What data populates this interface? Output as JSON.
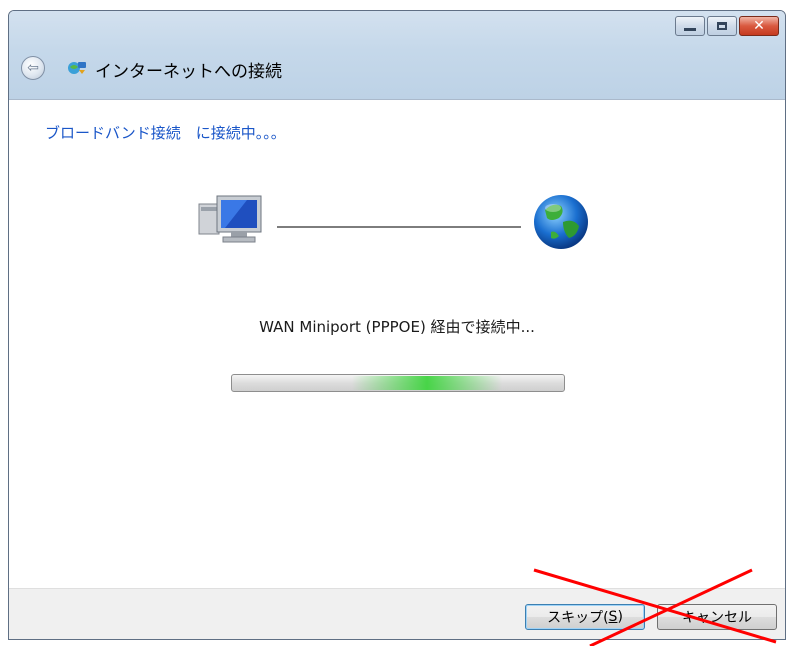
{
  "window": {
    "title": "インターネットへの接続",
    "controls": {
      "minimize_icon": "minimize-icon",
      "maximize_icon": "maximize-icon",
      "close_icon": "close-icon"
    }
  },
  "content": {
    "heading": "ブロードバンド接続　に接続中。。。",
    "status": "WAN Miniport (PPPOE) 経由で接続中...",
    "progress_indeterminate": true,
    "icons": {
      "computer": "computer-icon",
      "globe": "globe-icon",
      "back": "back-arrow-icon",
      "network": "network-connection-icon"
    }
  },
  "footer": {
    "skip_button": {
      "label_main": "スキップ(",
      "accel": "S",
      "label_end": ")"
    },
    "cancel_button": {
      "label": "キャンセル"
    }
  },
  "overlay": {
    "annotation": "red-x-mark",
    "color": "#ff0000"
  }
}
